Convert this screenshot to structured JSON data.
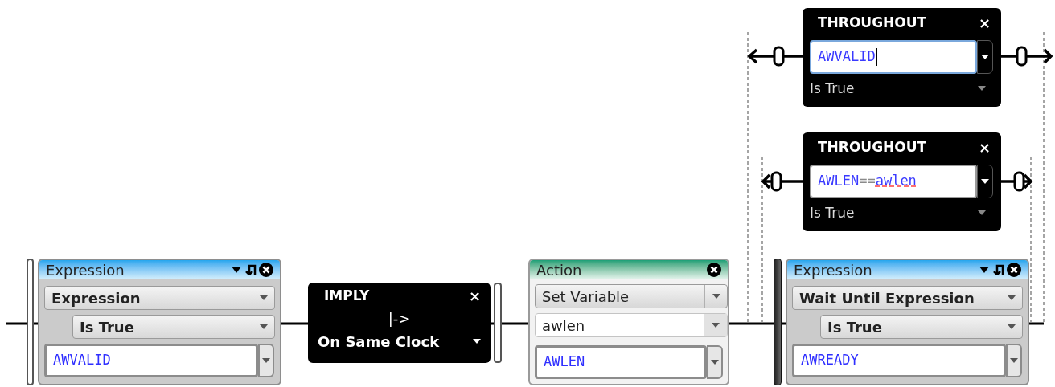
{
  "nodes": [
    {
      "kind": "throughout",
      "title": "THROUGHOUT",
      "close": "×",
      "focused": true,
      "tokens": [
        {
          "text": "AWVALID",
          "kind": "signal"
        }
      ],
      "condition": "Is True"
    },
    {
      "kind": "throughout",
      "title": "THROUGHOUT",
      "close": "×",
      "focused": false,
      "tokens": [
        {
          "text": "AWLEN",
          "kind": "signal"
        },
        {
          "text": "==",
          "kind": "operator"
        },
        {
          "text": "awlen",
          "kind": "misspelled"
        }
      ],
      "condition": "Is True"
    },
    {
      "kind": "expression",
      "title": "Expression",
      "type": "Expression",
      "condition": "Is True",
      "value": "AWVALID"
    },
    {
      "kind": "imply",
      "title": "IMPLY",
      "close": "×",
      "operator": "|->",
      "clock": "On Same Clock"
    },
    {
      "kind": "action",
      "title": "Action",
      "action": "Set Variable",
      "variable": "awlen",
      "value": "AWLEN"
    },
    {
      "kind": "expression",
      "title": "Expression",
      "type": "Wait Until Expression",
      "condition": "Is True",
      "value": "AWREADY"
    }
  ]
}
